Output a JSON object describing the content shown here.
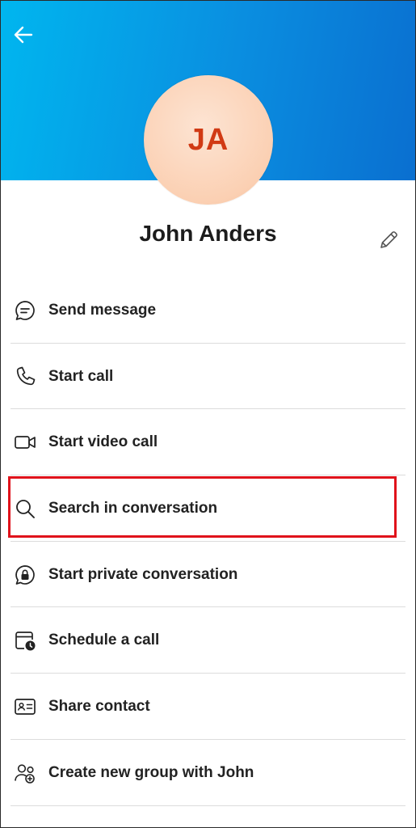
{
  "header": {
    "back_icon": "arrow-left-icon",
    "gradient_colors": [
      "#00b6ef",
      "#0a6fd0"
    ]
  },
  "profile": {
    "initials": "JA",
    "name": "John Anders",
    "edit_icon": "pencil-icon",
    "avatar_color": "#fbd0b3",
    "initials_color": "#d13a14"
  },
  "menu": {
    "items": [
      {
        "label": "Send message",
        "icon": "chat-bubble-icon"
      },
      {
        "label": "Start call",
        "icon": "phone-icon"
      },
      {
        "label": "Start video call",
        "icon": "video-camera-icon"
      },
      {
        "label": "Search in conversation",
        "icon": "search-icon"
      },
      {
        "label": "Start private conversation",
        "icon": "lock-chat-icon"
      },
      {
        "label": "Schedule a call",
        "icon": "calendar-clock-icon"
      },
      {
        "label": "Share contact",
        "icon": "contact-card-icon"
      },
      {
        "label": "Create new group with John",
        "icon": "people-add-icon"
      }
    ]
  },
  "highlight": {
    "target": "Search in conversation",
    "color": "#e0121b"
  }
}
